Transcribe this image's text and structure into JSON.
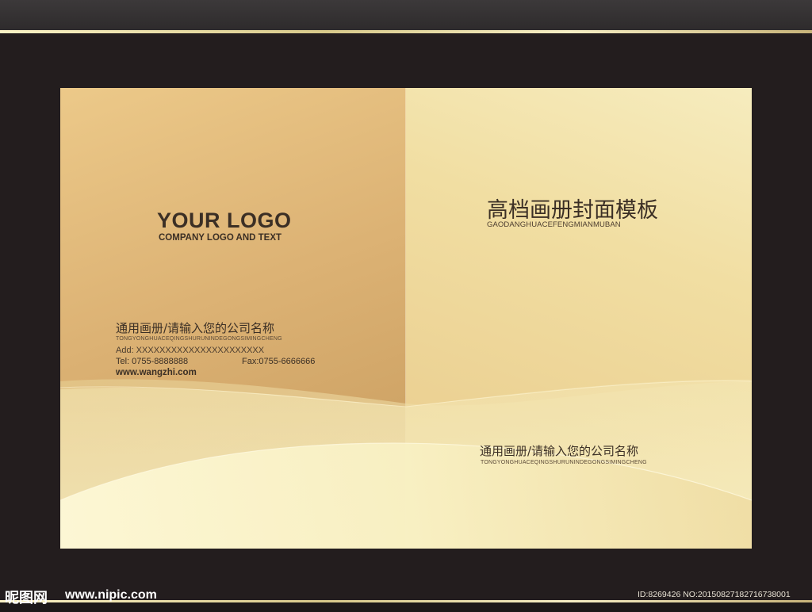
{
  "back_cover": {
    "logo_title": "YOUR LOGO",
    "logo_subtitle": "COMPANY LOGO AND TEXT",
    "company_name_cn": "通用画册/请输入您的公司名称",
    "company_name_pinyin": "TONGYONGHUACEQINGSHURUNINDEGONGSIMINGCHENG",
    "address": "Add: XXXXXXXXXXXXXXXXXXXXXX",
    "tel": "Tel: 0755-8888888",
    "fax": "Fax:0755-6666666",
    "website": "www.wangzhi.com"
  },
  "front_cover": {
    "title_cn": "高档画册封面模板",
    "title_pinyin": "GAODANGHUACEFENGMIANMUBAN",
    "company_name_cn": "通用画册/请输入您的公司名称",
    "company_name_pinyin": "TONGYONGHUACEQINGSHURUNINDEGONGSIMINGCHENG"
  },
  "watermark": {
    "site_logo": "昵图网",
    "site_url": "www.nipic.com",
    "image_id": "ID:8269426 NO:20150827182716738001"
  },
  "colors": {
    "background": "#231d1e",
    "gold_light": "#f6ecbe",
    "gold_dark": "#c69a5c",
    "text_dark": "#3b2f25"
  }
}
